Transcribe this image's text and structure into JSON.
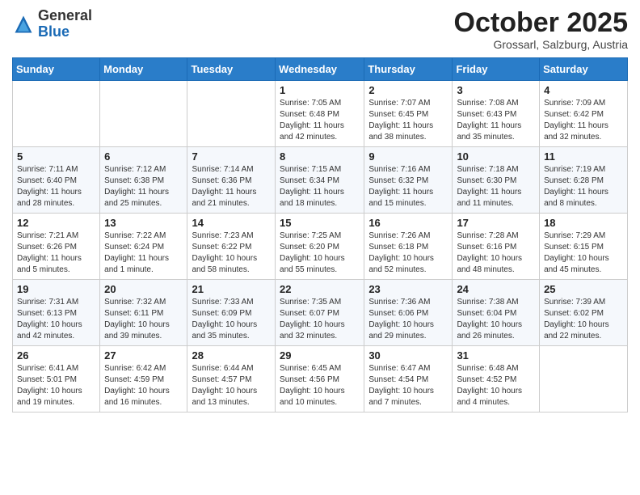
{
  "header": {
    "logo_general": "General",
    "logo_blue": "Blue",
    "month_title": "October 2025",
    "subtitle": "Grossarl, Salzburg, Austria"
  },
  "weekdays": [
    "Sunday",
    "Monday",
    "Tuesday",
    "Wednesday",
    "Thursday",
    "Friday",
    "Saturday"
  ],
  "weeks": [
    [
      {
        "day": "",
        "info": ""
      },
      {
        "day": "",
        "info": ""
      },
      {
        "day": "",
        "info": ""
      },
      {
        "day": "1",
        "info": "Sunrise: 7:05 AM\nSunset: 6:48 PM\nDaylight: 11 hours and 42 minutes."
      },
      {
        "day": "2",
        "info": "Sunrise: 7:07 AM\nSunset: 6:45 PM\nDaylight: 11 hours and 38 minutes."
      },
      {
        "day": "3",
        "info": "Sunrise: 7:08 AM\nSunset: 6:43 PM\nDaylight: 11 hours and 35 minutes."
      },
      {
        "day": "4",
        "info": "Sunrise: 7:09 AM\nSunset: 6:42 PM\nDaylight: 11 hours and 32 minutes."
      }
    ],
    [
      {
        "day": "5",
        "info": "Sunrise: 7:11 AM\nSunset: 6:40 PM\nDaylight: 11 hours and 28 minutes."
      },
      {
        "day": "6",
        "info": "Sunrise: 7:12 AM\nSunset: 6:38 PM\nDaylight: 11 hours and 25 minutes."
      },
      {
        "day": "7",
        "info": "Sunrise: 7:14 AM\nSunset: 6:36 PM\nDaylight: 11 hours and 21 minutes."
      },
      {
        "day": "8",
        "info": "Sunrise: 7:15 AM\nSunset: 6:34 PM\nDaylight: 11 hours and 18 minutes."
      },
      {
        "day": "9",
        "info": "Sunrise: 7:16 AM\nSunset: 6:32 PM\nDaylight: 11 hours and 15 minutes."
      },
      {
        "day": "10",
        "info": "Sunrise: 7:18 AM\nSunset: 6:30 PM\nDaylight: 11 hours and 11 minutes."
      },
      {
        "day": "11",
        "info": "Sunrise: 7:19 AM\nSunset: 6:28 PM\nDaylight: 11 hours and 8 minutes."
      }
    ],
    [
      {
        "day": "12",
        "info": "Sunrise: 7:21 AM\nSunset: 6:26 PM\nDaylight: 11 hours and 5 minutes."
      },
      {
        "day": "13",
        "info": "Sunrise: 7:22 AM\nSunset: 6:24 PM\nDaylight: 11 hours and 1 minute."
      },
      {
        "day": "14",
        "info": "Sunrise: 7:23 AM\nSunset: 6:22 PM\nDaylight: 10 hours and 58 minutes."
      },
      {
        "day": "15",
        "info": "Sunrise: 7:25 AM\nSunset: 6:20 PM\nDaylight: 10 hours and 55 minutes."
      },
      {
        "day": "16",
        "info": "Sunrise: 7:26 AM\nSunset: 6:18 PM\nDaylight: 10 hours and 52 minutes."
      },
      {
        "day": "17",
        "info": "Sunrise: 7:28 AM\nSunset: 6:16 PM\nDaylight: 10 hours and 48 minutes."
      },
      {
        "day": "18",
        "info": "Sunrise: 7:29 AM\nSunset: 6:15 PM\nDaylight: 10 hours and 45 minutes."
      }
    ],
    [
      {
        "day": "19",
        "info": "Sunrise: 7:31 AM\nSunset: 6:13 PM\nDaylight: 10 hours and 42 minutes."
      },
      {
        "day": "20",
        "info": "Sunrise: 7:32 AM\nSunset: 6:11 PM\nDaylight: 10 hours and 39 minutes."
      },
      {
        "day": "21",
        "info": "Sunrise: 7:33 AM\nSunset: 6:09 PM\nDaylight: 10 hours and 35 minutes."
      },
      {
        "day": "22",
        "info": "Sunrise: 7:35 AM\nSunset: 6:07 PM\nDaylight: 10 hours and 32 minutes."
      },
      {
        "day": "23",
        "info": "Sunrise: 7:36 AM\nSunset: 6:06 PM\nDaylight: 10 hours and 29 minutes."
      },
      {
        "day": "24",
        "info": "Sunrise: 7:38 AM\nSunset: 6:04 PM\nDaylight: 10 hours and 26 minutes."
      },
      {
        "day": "25",
        "info": "Sunrise: 7:39 AM\nSunset: 6:02 PM\nDaylight: 10 hours and 22 minutes."
      }
    ],
    [
      {
        "day": "26",
        "info": "Sunrise: 6:41 AM\nSunset: 5:01 PM\nDaylight: 10 hours and 19 minutes."
      },
      {
        "day": "27",
        "info": "Sunrise: 6:42 AM\nSunset: 4:59 PM\nDaylight: 10 hours and 16 minutes."
      },
      {
        "day": "28",
        "info": "Sunrise: 6:44 AM\nSunset: 4:57 PM\nDaylight: 10 hours and 13 minutes."
      },
      {
        "day": "29",
        "info": "Sunrise: 6:45 AM\nSunset: 4:56 PM\nDaylight: 10 hours and 10 minutes."
      },
      {
        "day": "30",
        "info": "Sunrise: 6:47 AM\nSunset: 4:54 PM\nDaylight: 10 hours and 7 minutes."
      },
      {
        "day": "31",
        "info": "Sunrise: 6:48 AM\nSunset: 4:52 PM\nDaylight: 10 hours and 4 minutes."
      },
      {
        "day": "",
        "info": ""
      }
    ]
  ]
}
